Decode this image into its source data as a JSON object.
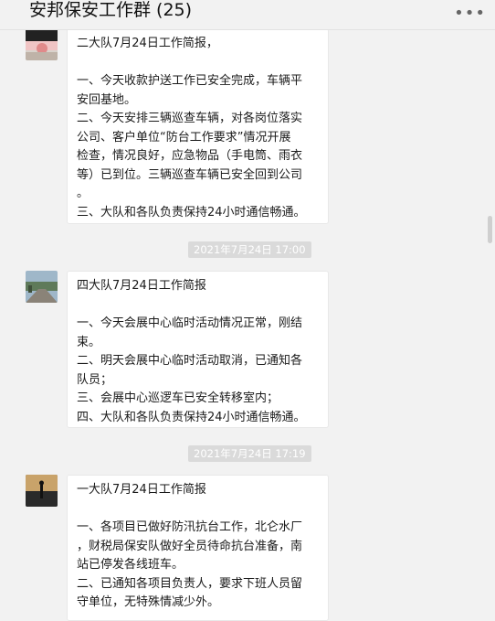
{
  "window": {
    "title": "安邦保安工作群 (25)",
    "more_icon": "more-dots-icon"
  },
  "messages": [
    {
      "avatar": "avatar-red-landscape",
      "lines": [
        "二大队7月24日工作简报，",
        "",
        "一、今天收款护送工作已安全完成，车辆平",
        "安回基地。",
        "二、今天安排三辆巡查车辆，对各岗位落实",
        "公司、客户单位“防台工作要求”情况开展",
        "检查，情况良好，应急物品（手电筒、雨衣",
        "等）已到位。三辆巡查车辆已安全回到公司",
        "。",
        "三、大队和各队负责保持24小时通信畅通。"
      ]
    },
    {
      "time": "2021年7月24日 17:00",
      "avatar": "avatar-road-landscape",
      "lines": [
        "四大队7月24日工作简报",
        "",
        "一、今天会展中心临时活动情况正常，刚结",
        "束。",
        "二、明天会展中心临时活动取消，已通知各",
        "队员；",
        "三、会展中心巡逻车已安全转移室内；",
        "四、大队和各队负责保持24小时通信畅通。"
      ]
    },
    {
      "time": "2021年7月24日 17:19",
      "avatar": "avatar-sunset-silhouette",
      "lines": [
        "一大队7月24日工作简报",
        "",
        "一、各项目已做好防汛抗台工作，北仑水厂",
        "，财税局保安队做好全员待命抗台准备，南",
        "站已停发各线班车。",
        "二、已通知各项目负责人，要求下班人员留",
        "守单位，无特殊情减少外。"
      ]
    }
  ]
}
